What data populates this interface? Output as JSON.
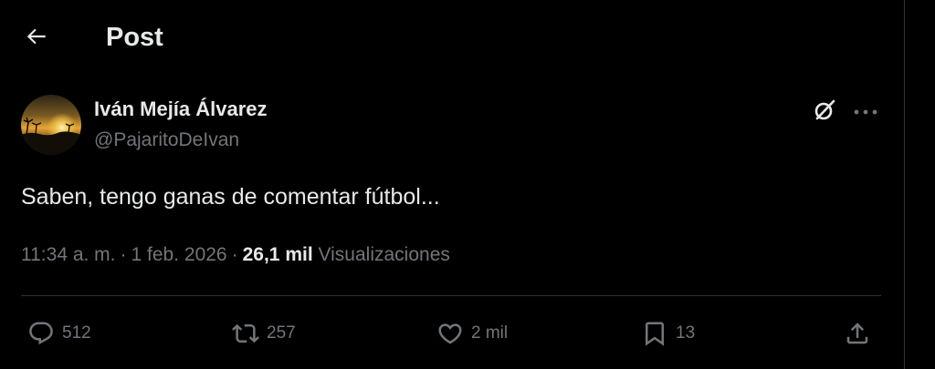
{
  "header": {
    "title": "Post",
    "back_icon": "arrow-left-icon"
  },
  "author": {
    "name": "Iván Mejía Álvarez",
    "handle": "@PajaritoDeIvan",
    "avatar": "sunset-beach-avatar"
  },
  "tweet": {
    "text": "Saben, tengo ganas de comentar fútbol...",
    "time": "11:34 a. m.",
    "separator": "·",
    "date": "1 feb. 2026",
    "views_count": "26,1 mil",
    "views_label": "Visualizaciones"
  },
  "actions": {
    "replies": "512",
    "reposts": "257",
    "likes": "2 mil",
    "bookmarks": "13"
  },
  "icons": {
    "grok": "grok-icon",
    "more": "more-horizontal-icon",
    "reply": "reply-icon",
    "repost": "repost-icon",
    "like": "heart-icon",
    "bookmark": "bookmark-icon",
    "share": "share-icon"
  },
  "colors": {
    "background": "#000000",
    "primary_text": "#e7e9ea",
    "secondary_text": "#71767b",
    "border": "#2f3336"
  }
}
